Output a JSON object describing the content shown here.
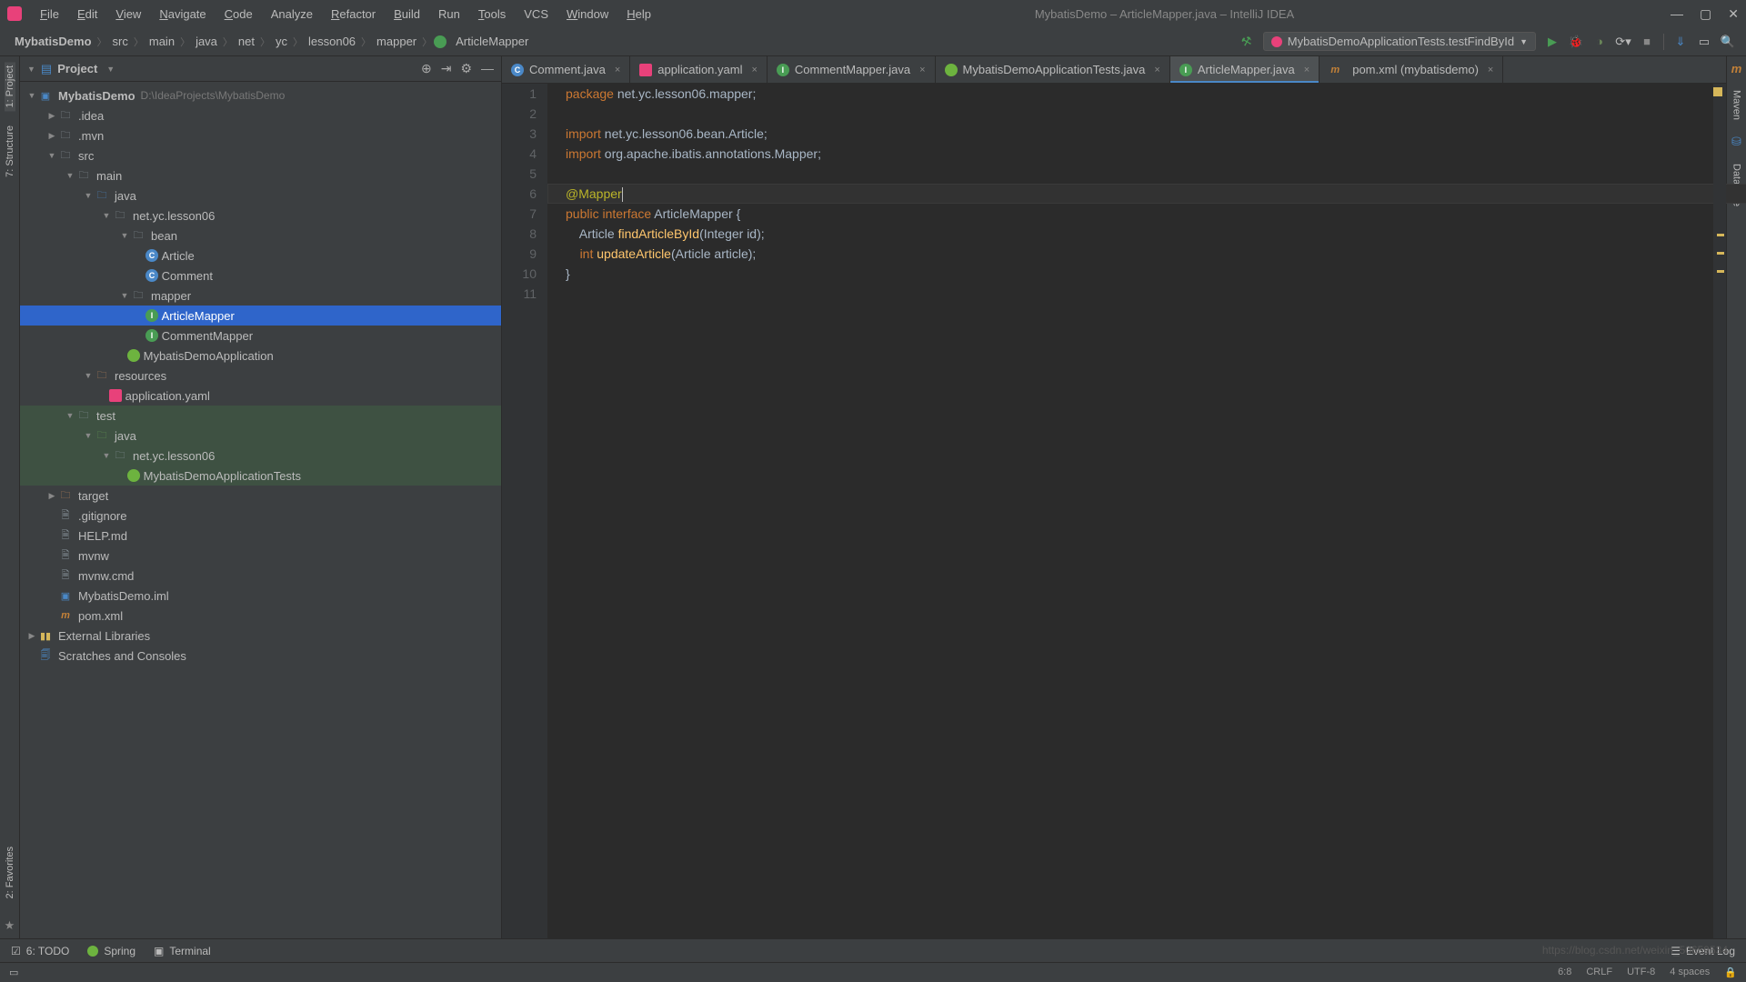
{
  "app": {
    "title": "MybatisDemo – ArticleMapper.java – IntelliJ IDEA"
  },
  "menu": {
    "file": "File",
    "edit": "Edit",
    "view": "View",
    "navigate": "Navigate",
    "code": "Code",
    "analyze": "Analyze",
    "refactor": "Refactor",
    "build": "Build",
    "run": "Run",
    "tools": "Tools",
    "vcs": "VCS",
    "window": "Window",
    "help": "Help"
  },
  "breadcrumbs": {
    "b0": "MybatisDemo",
    "b1": "src",
    "b2": "main",
    "b3": "java",
    "b4": "net",
    "b5": "yc",
    "b6": "lesson06",
    "b7": "mapper",
    "b8": "ArticleMapper"
  },
  "run_config": {
    "name": "MybatisDemoApplicationTests.testFindById"
  },
  "project_panel": {
    "title": "Project"
  },
  "tree": {
    "root": "MybatisDemo",
    "root_path": "D:\\IdeaProjects\\MybatisDemo",
    "idea": ".idea",
    "mvn": ".mvn",
    "src": "src",
    "main": "main",
    "java": "java",
    "pkg": "net.yc.lesson06",
    "bean": "bean",
    "article": "Article",
    "comment": "Comment",
    "mapper": "mapper",
    "articleMapper": "ArticleMapper",
    "commentMapper": "CommentMapper",
    "app": "MybatisDemoApplication",
    "resources": "resources",
    "yaml": "application.yaml",
    "test": "test",
    "test_java": "java",
    "test_pkg": "net.yc.lesson06",
    "test_cls": "MybatisDemoApplicationTests",
    "target": "target",
    "gitignore": ".gitignore",
    "help": "HELP.md",
    "mvnw": "mvnw",
    "mvnwcmd": "mvnw.cmd",
    "iml": "MybatisDemo.iml",
    "pom": "pom.xml",
    "ext_lib": "External Libraries",
    "scratches": "Scratches and Consoles"
  },
  "tabs": {
    "t0": "Comment.java",
    "t1": "application.yaml",
    "t2": "CommentMapper.java",
    "t3": "MybatisDemoApplicationTests.java",
    "t4": "ArticleMapper.java",
    "t5": "pom.xml (mybatisdemo)"
  },
  "gutter": {
    "l1": "1",
    "l2": "2",
    "l3": "3",
    "l4": "4",
    "l5": "5",
    "l6": "6",
    "l7": "7",
    "l8": "8",
    "l9": "9",
    "l10": "10",
    "l11": "11"
  },
  "code": {
    "pkg_kw": "package ",
    "pkg": "net.yc.lesson06.mapper;",
    "imp_kw": "import ",
    "imp1": "net.yc.lesson06.bean.Article;",
    "imp2": "org.apache.ibatis.annotations.Mapper;",
    "anno": "@Mapper",
    "public_kw": "public ",
    "interface_kw": "interface ",
    "cls": "ArticleMapper ",
    "brace_open": "{",
    "l8_pad": "    Article ",
    "m1": "findArticleById",
    "m1_args": "(Integer id);",
    "l9_pad": "    ",
    "int_kw": "int ",
    "m2": "updateArticle",
    "m2_args": "(Article article);",
    "brace_close": "}"
  },
  "bottom": {
    "todo": "6: TODO",
    "spring": "Spring",
    "terminal": "Terminal",
    "event_log": "Event Log"
  },
  "status": {
    "pos": "6:8",
    "enc": "CRLF",
    "charset": "UTF-8",
    "indent": "4 spaces"
  },
  "right_tools": {
    "maven": "Maven",
    "database": "Database"
  },
  "left_tools": {
    "project": "1: Project",
    "structure": "7: Structure",
    "favorites": "2: Favorites"
  },
  "watermark": "https://blog.csdn.net/weixin_50659534"
}
